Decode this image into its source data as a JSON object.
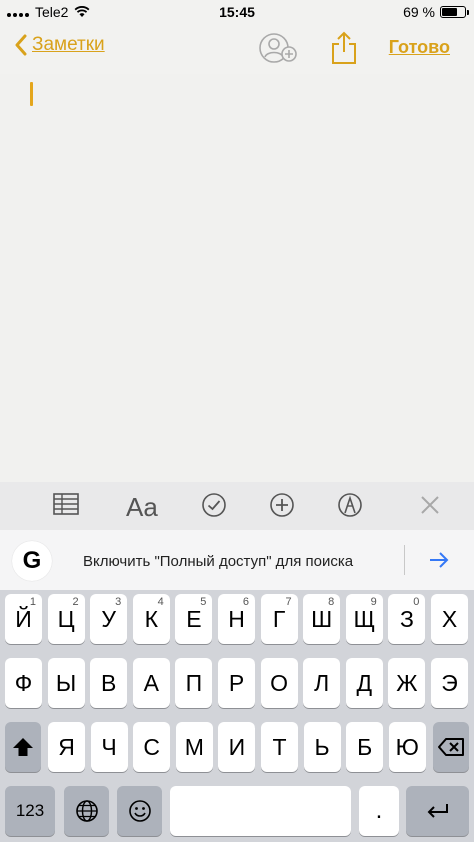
{
  "status": {
    "carrier": "Tele2",
    "time": "15:45",
    "battery_percent": "69 %",
    "battery_level": 0.69
  },
  "nav": {
    "back_label": "Заметки",
    "done_label": "Готово"
  },
  "toolbar": {
    "text_style": "Aa"
  },
  "suggestion": {
    "logo": "G",
    "text": "Включить \"Полный доступ\" для поиска"
  },
  "keyboard": {
    "row1": [
      {
        "label": "Й",
        "num": "1"
      },
      {
        "label": "Ц",
        "num": "2"
      },
      {
        "label": "У",
        "num": "3"
      },
      {
        "label": "К",
        "num": "4"
      },
      {
        "label": "Е",
        "num": "5"
      },
      {
        "label": "Н",
        "num": "6"
      },
      {
        "label": "Г",
        "num": "7"
      },
      {
        "label": "Ш",
        "num": "8"
      },
      {
        "label": "Щ",
        "num": "9"
      },
      {
        "label": "З",
        "num": "0"
      },
      {
        "label": "Х",
        "num": ""
      }
    ],
    "row2": [
      "Ф",
      "Ы",
      "В",
      "А",
      "П",
      "Р",
      "О",
      "Л",
      "Д",
      "Ж",
      "Э"
    ],
    "row3": [
      "Я",
      "Ч",
      "С",
      "М",
      "И",
      "Т",
      "Ь",
      "Б",
      "Ю"
    ],
    "numbers_key": "123",
    "period_key": "."
  },
  "icons": {
    "back": "chevron-left-icon",
    "add_person": "add-person-icon",
    "share": "share-icon",
    "table": "table-icon",
    "checklist": "checkmark-circle-icon",
    "add": "plus-circle-icon",
    "markup": "markup-pen-icon",
    "close": "close-icon",
    "shift": "shift-icon",
    "backspace": "backspace-icon",
    "globe": "globe-icon",
    "emoji": "emoji-icon",
    "return": "return-icon",
    "arrow": "arrow-right-icon"
  },
  "colors": {
    "accent": "#d9a21b",
    "blue_arrow": "#3478f6"
  }
}
